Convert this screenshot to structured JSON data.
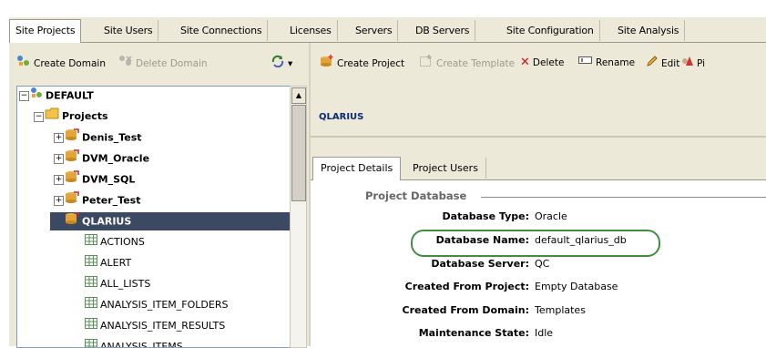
{
  "tabs": [
    "Site Projects",
    "Site Users",
    "Site Connections",
    "Licenses",
    "Servers",
    "DB Servers",
    "Site Configuration",
    "Site Analysis"
  ],
  "left_toolbar": {
    "create_domain": "Create Domain",
    "delete_domain": "Delete Domain",
    "refresh_menu": "▾"
  },
  "tree": {
    "root": "DEFAULT",
    "projects": "Projects",
    "items": [
      "Denis_Test",
      "DVM_Oracle",
      "DVM_SQL",
      "Peter_Test",
      "QLARIUS"
    ],
    "tables": [
      "ACTIONS",
      "ALERT",
      "ALL_LISTS",
      "ANALYSIS_ITEM_FOLDERS",
      "ANALYSIS_ITEM_RESULTS",
      "ANALYSIS_ITEMS"
    ]
  },
  "right_toolbar": {
    "create_project": "Create Project",
    "create_template": "Create Template",
    "delete": "Delete",
    "rename": "Rename",
    "edit": "Edit",
    "pin": "Pi"
  },
  "project_name": "QLARIUS",
  "subtabs": [
    "Project Details",
    "Project Users"
  ],
  "details": {
    "section": "Project Database",
    "fields": [
      {
        "label": "Database Type:",
        "value": "Oracle"
      },
      {
        "label": "Database Name:",
        "value": "default_qlarius_db"
      },
      {
        "label": "Database Server:",
        "value": "QC"
      },
      {
        "label": "Created From Project:",
        "value": "Empty Database"
      },
      {
        "label": "Created From Domain:",
        "value": "Templates"
      },
      {
        "label": "Maintenance State:",
        "value": "Idle"
      }
    ]
  },
  "colors": {
    "selected_row": "#3b4a62",
    "project_title": "#0a2a7a",
    "highlight_oval": "#3f8f3f"
  }
}
